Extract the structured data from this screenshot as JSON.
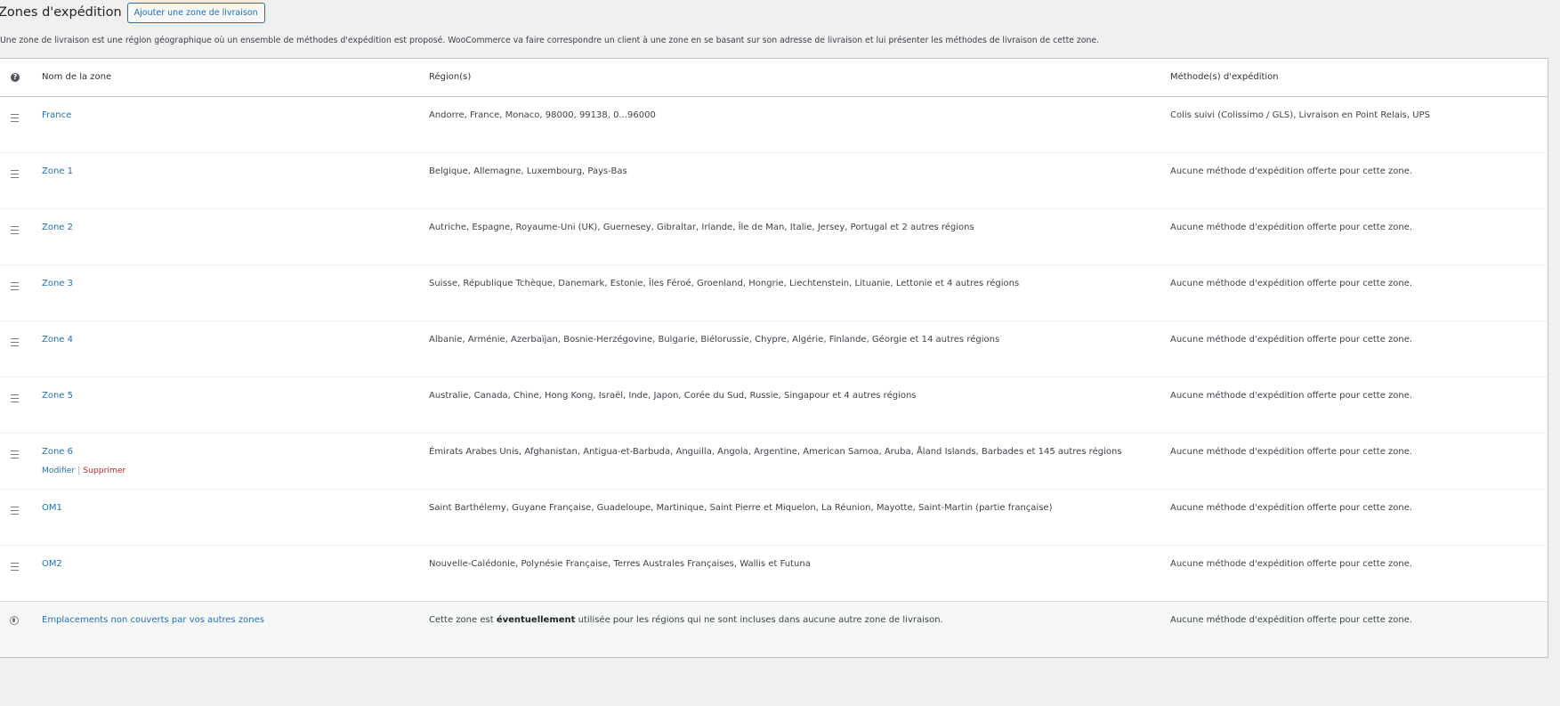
{
  "header": {
    "title": "Zones d'expédition",
    "add_button": "Ajouter une zone de livraison"
  },
  "intro": "Une zone de livraison est une région géographique où un ensemble de méthodes d'expédition est proposé. WooCommerce va faire correspondre un client à une zone en se basant sur son adresse de livraison et lui présenter les méthodes de livraison de cette zone.",
  "table": {
    "columns": {
      "name": "Nom de la zone",
      "regions": "Région(s)",
      "methods": "Méthode(s) d'expédition"
    },
    "row_actions": {
      "edit": "Modifier",
      "separator": "|",
      "delete": "Supprimer"
    },
    "rows": [
      {
        "name": "France",
        "regions": "Andorre, France, Monaco, 98000, 99138, 0...96000",
        "methods": "Colis suivi (Colissimo / GLS), Livraison en Point Relais, UPS"
      },
      {
        "name": "Zone 1",
        "regions": "Belgique, Allemagne, Luxembourg, Pays-Bas",
        "methods": "Aucune méthode d'expédition offerte pour cette zone."
      },
      {
        "name": "Zone 2",
        "regions": "Autriche, Espagne, Royaume-Uni (UK), Guernesey, Gibraltar, Irlande, Île de Man, Italie, Jersey, Portugal et 2 autres régions",
        "methods": "Aucune méthode d'expédition offerte pour cette zone."
      },
      {
        "name": "Zone 3",
        "regions": "Suisse, République Tchèque, Danemark, Estonie, Îles Féroé, Groenland, Hongrie, Liechtenstein, Lituanie, Lettonie et 4 autres régions",
        "methods": "Aucune méthode d'expédition offerte pour cette zone."
      },
      {
        "name": "Zone 4",
        "regions": "Albanie, Arménie, Azerbaïjan, Bosnie-Herzégovine, Bulgarie, Biélorussie, Chypre, Algérie, Finlande, Géorgie et 14 autres régions",
        "methods": "Aucune méthode d'expédition offerte pour cette zone."
      },
      {
        "name": "Zone 5",
        "regions": "Australie, Canada, Chine, Hong Kong, Israël, Inde, Japon, Corée du Sud, Russie, Singapour et 4 autres régions",
        "methods": "Aucune méthode d'expédition offerte pour cette zone."
      },
      {
        "name": "Zone 6",
        "regions": "Émirats Arabes Unis, Afghanistan, Antigua-et-Barbuda, Anguilla, Angola, Argentine, American Samoa, Aruba, Åland Islands, Barbades et 145 autres régions",
        "methods": "Aucune méthode d'expédition offerte pour cette zone."
      },
      {
        "name": "OM1",
        "regions": "Saint Barthélemy, Guyane Française, Guadeloupe, Martinique, Saint Pierre et Miquelon, La Réunion, Mayotte, Saint-Martin (partie française)",
        "methods": "Aucune méthode d'expédition offerte pour cette zone."
      },
      {
        "name": "OM2",
        "regions": "Nouvelle-Calédonie, Polynésie Française, Terres Australes Françaises, Wallis et Futuna",
        "methods": "Aucune méthode d'expédition offerte pour cette zone."
      }
    ],
    "rest_of_world": {
      "name": "Emplacements non couverts par vos autres zones",
      "region_before": "Cette zone est ",
      "region_bold": "éventuellement",
      "region_after": " utilisée pour les régions qui ne sont incluses dans aucune autre zone de livraison.",
      "methods": "Aucune méthode d'expédition offerte pour cette zone."
    }
  },
  "colors": {
    "link": "#2271b1",
    "delete": "#b32d2e",
    "background": "#f0f0f1"
  }
}
